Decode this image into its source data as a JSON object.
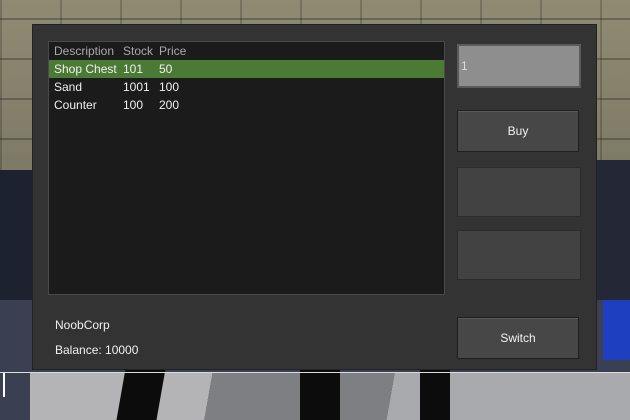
{
  "shop": {
    "columns": [
      "Description",
      "Stock",
      "Price"
    ],
    "items": [
      {
        "description": "Shop Chest",
        "stock": "101",
        "price": "50",
        "selected": true
      },
      {
        "description": "Sand",
        "stock": "1001",
        "price": "100",
        "selected": false
      },
      {
        "description": "Counter",
        "stock": "100",
        "price": "200",
        "selected": false
      }
    ]
  },
  "purchase": {
    "quantity_value": "1",
    "buy_label": "Buy"
  },
  "account": {
    "company": "NoobCorp",
    "balance_text": "Balance: 10000",
    "switch_label": "Switch"
  },
  "colors": {
    "selected_row": "#4b7a35",
    "panel": "#333333",
    "list_bg": "#1b1b1b"
  }
}
